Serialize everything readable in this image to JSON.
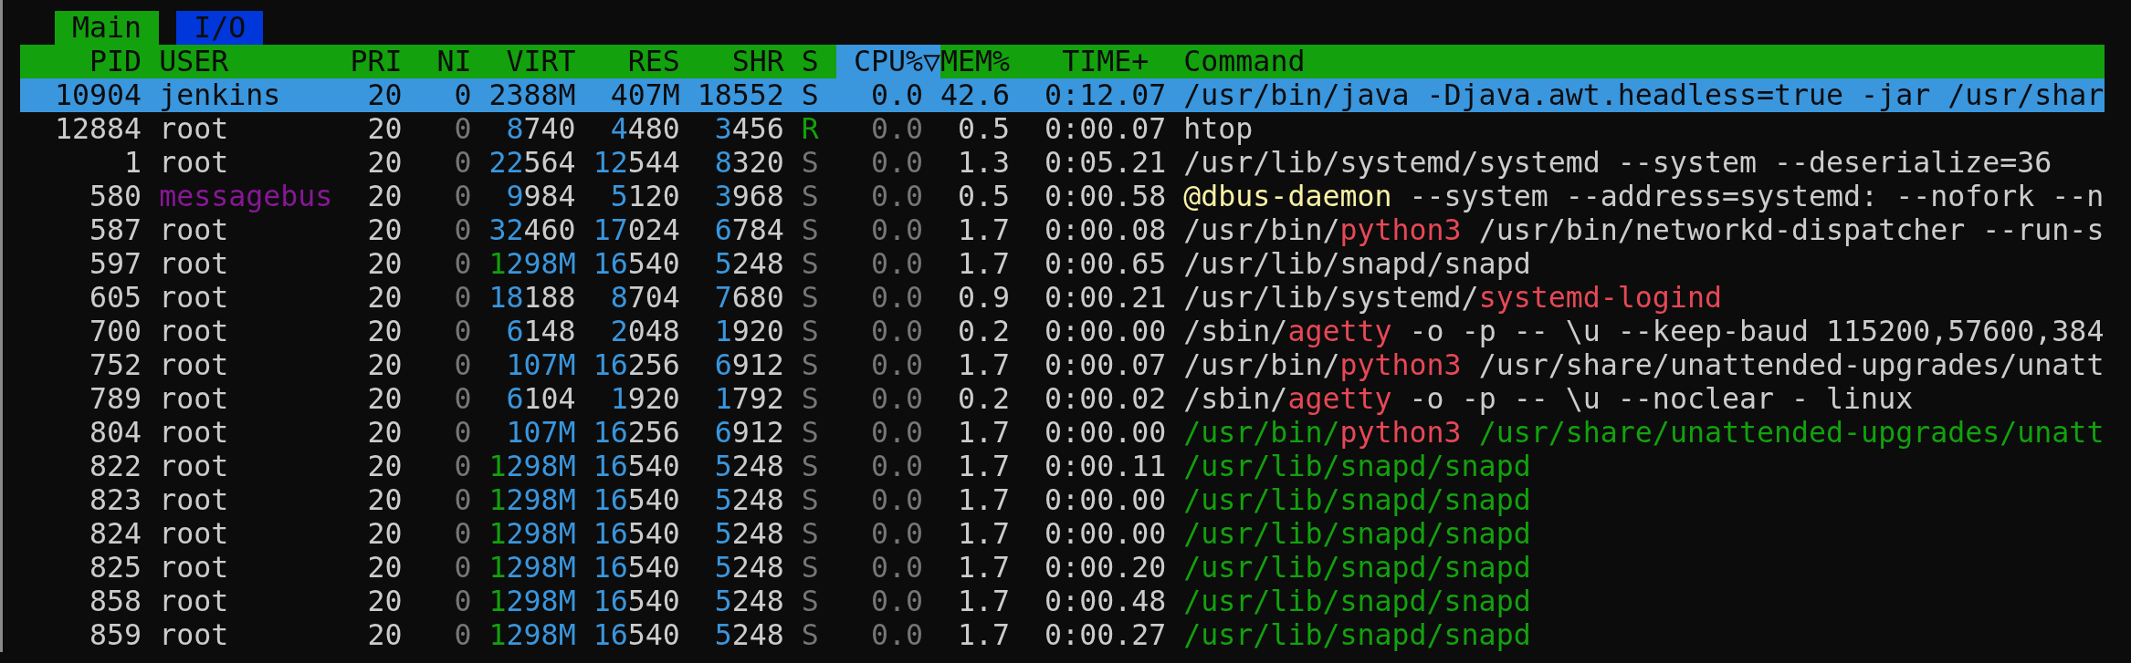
{
  "tabs": [
    {
      "label": "Main",
      "selected": true
    },
    {
      "label": "I/O",
      "selected": false
    }
  ],
  "columns": [
    {
      "label": "PID",
      "sorted": false
    },
    {
      "label": "USER",
      "sorted": false
    },
    {
      "label": "PRI",
      "sorted": false
    },
    {
      "label": "NI",
      "sorted": false
    },
    {
      "label": "VIRT",
      "sorted": false
    },
    {
      "label": "RES",
      "sorted": false
    },
    {
      "label": "SHR",
      "sorted": false
    },
    {
      "label": "S",
      "sorted": false
    },
    {
      "label": "CPU%",
      "sorted": true,
      "sort_indicator": "▽"
    },
    {
      "label": "MEM%",
      "sorted": false
    },
    {
      "label": "TIME+",
      "sorted": false
    },
    {
      "label": "Command",
      "sorted": false
    }
  ],
  "rows": [
    {
      "selected": true,
      "pid": "10904",
      "user": "jenkins",
      "pri": "20",
      "ni": "0",
      "virt": "2388M",
      "res": "407M",
      "shr": "18552",
      "state": "S",
      "cpu": "0.0",
      "mem": "42.6",
      "time": "0:12.07",
      "command": "/usr/bin/java -Djava.awt.headless=true -jar /usr/shar"
    },
    {
      "selected": false,
      "pid": "12884",
      "user": "root",
      "pri": "20",
      "ni": [
        {
          "text": "0",
          "color": "#767676"
        }
      ],
      "virt": [
        {
          "text": "8",
          "color": "#3a96dd"
        },
        {
          "text": "740",
          "color": "#cccccc"
        }
      ],
      "res": [
        {
          "text": "4",
          "color": "#3a96dd"
        },
        {
          "text": "480",
          "color": "#cccccc"
        }
      ],
      "shr": [
        {
          "text": "3",
          "color": "#3a96dd"
        },
        {
          "text": "456",
          "color": "#cccccc"
        }
      ],
      "state": [
        {
          "text": "R",
          "color": "#13a10e"
        }
      ],
      "cpu": [
        {
          "text": "0.0",
          "color": "#767676"
        }
      ],
      "mem": "0.5",
      "time": "0:00.07",
      "command": "htop"
    },
    {
      "selected": false,
      "pid": "1",
      "user": "root",
      "pri": "20",
      "ni": [
        {
          "text": "0",
          "color": "#767676"
        }
      ],
      "virt": [
        {
          "text": "22",
          "color": "#3a96dd"
        },
        {
          "text": "564",
          "color": "#cccccc"
        }
      ],
      "res": [
        {
          "text": "12",
          "color": "#3a96dd"
        },
        {
          "text": "544",
          "color": "#cccccc"
        }
      ],
      "shr": [
        {
          "text": "8",
          "color": "#3a96dd"
        },
        {
          "text": "320",
          "color": "#cccccc"
        }
      ],
      "state": [
        {
          "text": "S",
          "color": "#767676"
        }
      ],
      "cpu": [
        {
          "text": "0.0",
          "color": "#767676"
        }
      ],
      "mem": "1.3",
      "time": "0:05.21",
      "command": "/usr/lib/systemd/systemd --system --deserialize=36"
    },
    {
      "selected": false,
      "pid": "580",
      "user": [
        {
          "text": "messagebus",
          "color": "#881798"
        }
      ],
      "pri": "20",
      "ni": [
        {
          "text": "0",
          "color": "#767676"
        }
      ],
      "virt": [
        {
          "text": "9",
          "color": "#3a96dd"
        },
        {
          "text": "984",
          "color": "#cccccc"
        }
      ],
      "res": [
        {
          "text": "5",
          "color": "#3a96dd"
        },
        {
          "text": "120",
          "color": "#cccccc"
        }
      ],
      "shr": [
        {
          "text": "3",
          "color": "#3a96dd"
        },
        {
          "text": "968",
          "color": "#cccccc"
        }
      ],
      "state": [
        {
          "text": "S",
          "color": "#767676"
        }
      ],
      "cpu": [
        {
          "text": "0.0",
          "color": "#767676"
        }
      ],
      "mem": "0.5",
      "time": "0:00.58",
      "command": [
        {
          "text": "@dbus-daemon",
          "color": "#f9f1a5"
        },
        {
          "text": " --system --address=systemd: --nofork --n",
          "color": "#cccccc"
        }
      ]
    },
    {
      "selected": false,
      "pid": "587",
      "user": "root",
      "pri": "20",
      "ni": [
        {
          "text": "0",
          "color": "#767676"
        }
      ],
      "virt": [
        {
          "text": "32",
          "color": "#3a96dd"
        },
        {
          "text": "460",
          "color": "#cccccc"
        }
      ],
      "res": [
        {
          "text": "17",
          "color": "#3a96dd"
        },
        {
          "text": "024",
          "color": "#cccccc"
        }
      ],
      "shr": [
        {
          "text": "6",
          "color": "#3a96dd"
        },
        {
          "text": "784",
          "color": "#cccccc"
        }
      ],
      "state": [
        {
          "text": "S",
          "color": "#767676"
        }
      ],
      "cpu": [
        {
          "text": "0.0",
          "color": "#767676"
        }
      ],
      "mem": "1.7",
      "time": "0:00.08",
      "command": [
        {
          "text": "/usr/bin/",
          "color": "#cccccc"
        },
        {
          "text": "python3",
          "color": "#e74856"
        },
        {
          "text": " /usr/bin/networkd-dispatcher --run-s",
          "color": "#cccccc"
        }
      ]
    },
    {
      "selected": false,
      "pid": "597",
      "user": "root",
      "pri": "20",
      "ni": [
        {
          "text": "0",
          "color": "#767676"
        }
      ],
      "virt": [
        {
          "text": "1",
          "color": "#13a10e"
        },
        {
          "text": "298M",
          "color": "#3a96dd"
        }
      ],
      "res": [
        {
          "text": "16",
          "color": "#3a96dd"
        },
        {
          "text": "540",
          "color": "#cccccc"
        }
      ],
      "shr": [
        {
          "text": "5",
          "color": "#3a96dd"
        },
        {
          "text": "248",
          "color": "#cccccc"
        }
      ],
      "state": [
        {
          "text": "S",
          "color": "#767676"
        }
      ],
      "cpu": [
        {
          "text": "0.0",
          "color": "#767676"
        }
      ],
      "mem": "1.7",
      "time": "0:00.65",
      "command": "/usr/lib/snapd/snapd"
    },
    {
      "selected": false,
      "pid": "605",
      "user": "root",
      "pri": "20",
      "ni": [
        {
          "text": "0",
          "color": "#767676"
        }
      ],
      "virt": [
        {
          "text": "18",
          "color": "#3a96dd"
        },
        {
          "text": "188",
          "color": "#cccccc"
        }
      ],
      "res": [
        {
          "text": "8",
          "color": "#3a96dd"
        },
        {
          "text": "704",
          "color": "#cccccc"
        }
      ],
      "shr": [
        {
          "text": "7",
          "color": "#3a96dd"
        },
        {
          "text": "680",
          "color": "#cccccc"
        }
      ],
      "state": [
        {
          "text": "S",
          "color": "#767676"
        }
      ],
      "cpu": [
        {
          "text": "0.0",
          "color": "#767676"
        }
      ],
      "mem": "0.9",
      "time": "0:00.21",
      "command": [
        {
          "text": "/usr/lib/systemd/",
          "color": "#cccccc"
        },
        {
          "text": "systemd-logind",
          "color": "#e74856"
        }
      ]
    },
    {
      "selected": false,
      "pid": "700",
      "user": "root",
      "pri": "20",
      "ni": [
        {
          "text": "0",
          "color": "#767676"
        }
      ],
      "virt": [
        {
          "text": "6",
          "color": "#3a96dd"
        },
        {
          "text": "148",
          "color": "#cccccc"
        }
      ],
      "res": [
        {
          "text": "2",
          "color": "#3a96dd"
        },
        {
          "text": "048",
          "color": "#cccccc"
        }
      ],
      "shr": [
        {
          "text": "1",
          "color": "#3a96dd"
        },
        {
          "text": "920",
          "color": "#cccccc"
        }
      ],
      "state": [
        {
          "text": "S",
          "color": "#767676"
        }
      ],
      "cpu": [
        {
          "text": "0.0",
          "color": "#767676"
        }
      ],
      "mem": "0.2",
      "time": "0:00.00",
      "command": [
        {
          "text": "/sbin/",
          "color": "#cccccc"
        },
        {
          "text": "agetty",
          "color": "#e74856"
        },
        {
          "text": " -o -p -- \\u --keep-baud 115200,57600,384",
          "color": "#cccccc"
        }
      ]
    },
    {
      "selected": false,
      "pid": "752",
      "user": "root",
      "pri": "20",
      "ni": [
        {
          "text": "0",
          "color": "#767676"
        }
      ],
      "virt": [
        {
          "text": "107M",
          "color": "#3a96dd"
        }
      ],
      "res": [
        {
          "text": "16",
          "color": "#3a96dd"
        },
        {
          "text": "256",
          "color": "#cccccc"
        }
      ],
      "shr": [
        {
          "text": "6",
          "color": "#3a96dd"
        },
        {
          "text": "912",
          "color": "#cccccc"
        }
      ],
      "state": [
        {
          "text": "S",
          "color": "#767676"
        }
      ],
      "cpu": [
        {
          "text": "0.0",
          "color": "#767676"
        }
      ],
      "mem": "1.7",
      "time": "0:00.07",
      "command": [
        {
          "text": "/usr/bin/",
          "color": "#cccccc"
        },
        {
          "text": "python3",
          "color": "#e74856"
        },
        {
          "text": " /usr/share/unattended-upgrades/unatt",
          "color": "#cccccc"
        }
      ]
    },
    {
      "selected": false,
      "pid": "789",
      "user": "root",
      "pri": "20",
      "ni": [
        {
          "text": "0",
          "color": "#767676"
        }
      ],
      "virt": [
        {
          "text": "6",
          "color": "#3a96dd"
        },
        {
          "text": "104",
          "color": "#cccccc"
        }
      ],
      "res": [
        {
          "text": "1",
          "color": "#3a96dd"
        },
        {
          "text": "920",
          "color": "#cccccc"
        }
      ],
      "shr": [
        {
          "text": "1",
          "color": "#3a96dd"
        },
        {
          "text": "792",
          "color": "#cccccc"
        }
      ],
      "state": [
        {
          "text": "S",
          "color": "#767676"
        }
      ],
      "cpu": [
        {
          "text": "0.0",
          "color": "#767676"
        }
      ],
      "mem": "0.2",
      "time": "0:00.02",
      "command": [
        {
          "text": "/sbin/",
          "color": "#cccccc"
        },
        {
          "text": "agetty",
          "color": "#e74856"
        },
        {
          "text": " -o -p -- \\u --noclear - linux",
          "color": "#cccccc"
        }
      ]
    },
    {
      "selected": false,
      "pid": "804",
      "user": "root",
      "pri": "20",
      "ni": [
        {
          "text": "0",
          "color": "#767676"
        }
      ],
      "virt": [
        {
          "text": "107M",
          "color": "#3a96dd"
        }
      ],
      "res": [
        {
          "text": "16",
          "color": "#3a96dd"
        },
        {
          "text": "256",
          "color": "#cccccc"
        }
      ],
      "shr": [
        {
          "text": "6",
          "color": "#3a96dd"
        },
        {
          "text": "912",
          "color": "#cccccc"
        }
      ],
      "state": [
        {
          "text": "S",
          "color": "#767676"
        }
      ],
      "cpu": [
        {
          "text": "0.0",
          "color": "#767676"
        }
      ],
      "mem": "1.7",
      "time": "0:00.00",
      "command": [
        {
          "text": "/usr/bin/",
          "color": "#13a10e"
        },
        {
          "text": "python3",
          "color": "#e74856"
        },
        {
          "text": " /usr/share/unattended-upgrades/unatt",
          "color": "#13a10e"
        }
      ]
    },
    {
      "selected": false,
      "pid": "822",
      "user": "root",
      "pri": "20",
      "ni": [
        {
          "text": "0",
          "color": "#767676"
        }
      ],
      "virt": [
        {
          "text": "1",
          "color": "#13a10e"
        },
        {
          "text": "298M",
          "color": "#3a96dd"
        }
      ],
      "res": [
        {
          "text": "16",
          "color": "#3a96dd"
        },
        {
          "text": "540",
          "color": "#cccccc"
        }
      ],
      "shr": [
        {
          "text": "5",
          "color": "#3a96dd"
        },
        {
          "text": "248",
          "color": "#cccccc"
        }
      ],
      "state": [
        {
          "text": "S",
          "color": "#767676"
        }
      ],
      "cpu": [
        {
          "text": "0.0",
          "color": "#767676"
        }
      ],
      "mem": "1.7",
      "time": "0:00.11",
      "command": [
        {
          "text": "/usr/lib/snapd/snapd",
          "color": "#13a10e"
        }
      ]
    },
    {
      "selected": false,
      "pid": "823",
      "user": "root",
      "pri": "20",
      "ni": [
        {
          "text": "0",
          "color": "#767676"
        }
      ],
      "virt": [
        {
          "text": "1",
          "color": "#13a10e"
        },
        {
          "text": "298M",
          "color": "#3a96dd"
        }
      ],
      "res": [
        {
          "text": "16",
          "color": "#3a96dd"
        },
        {
          "text": "540",
          "color": "#cccccc"
        }
      ],
      "shr": [
        {
          "text": "5",
          "color": "#3a96dd"
        },
        {
          "text": "248",
          "color": "#cccccc"
        }
      ],
      "state": [
        {
          "text": "S",
          "color": "#767676"
        }
      ],
      "cpu": [
        {
          "text": "0.0",
          "color": "#767676"
        }
      ],
      "mem": "1.7",
      "time": "0:00.00",
      "command": [
        {
          "text": "/usr/lib/snapd/snapd",
          "color": "#13a10e"
        }
      ]
    },
    {
      "selected": false,
      "pid": "824",
      "user": "root",
      "pri": "20",
      "ni": [
        {
          "text": "0",
          "color": "#767676"
        }
      ],
      "virt": [
        {
          "text": "1",
          "color": "#13a10e"
        },
        {
          "text": "298M",
          "color": "#3a96dd"
        }
      ],
      "res": [
        {
          "text": "16",
          "color": "#3a96dd"
        },
        {
          "text": "540",
          "color": "#cccccc"
        }
      ],
      "shr": [
        {
          "text": "5",
          "color": "#3a96dd"
        },
        {
          "text": "248",
          "color": "#cccccc"
        }
      ],
      "state": [
        {
          "text": "S",
          "color": "#767676"
        }
      ],
      "cpu": [
        {
          "text": "0.0",
          "color": "#767676"
        }
      ],
      "mem": "1.7",
      "time": "0:00.00",
      "command": [
        {
          "text": "/usr/lib/snapd/snapd",
          "color": "#13a10e"
        }
      ]
    },
    {
      "selected": false,
      "pid": "825",
      "user": "root",
      "pri": "20",
      "ni": [
        {
          "text": "0",
          "color": "#767676"
        }
      ],
      "virt": [
        {
          "text": "1",
          "color": "#13a10e"
        },
        {
          "text": "298M",
          "color": "#3a96dd"
        }
      ],
      "res": [
        {
          "text": "16",
          "color": "#3a96dd"
        },
        {
          "text": "540",
          "color": "#cccccc"
        }
      ],
      "shr": [
        {
          "text": "5",
          "color": "#3a96dd"
        },
        {
          "text": "248",
          "color": "#cccccc"
        }
      ],
      "state": [
        {
          "text": "S",
          "color": "#767676"
        }
      ],
      "cpu": [
        {
          "text": "0.0",
          "color": "#767676"
        }
      ],
      "mem": "1.7",
      "time": "0:00.20",
      "command": [
        {
          "text": "/usr/lib/snapd/snapd",
          "color": "#13a10e"
        }
      ]
    },
    {
      "selected": false,
      "pid": "858",
      "user": "root",
      "pri": "20",
      "ni": [
        {
          "text": "0",
          "color": "#767676"
        }
      ],
      "virt": [
        {
          "text": "1",
          "color": "#13a10e"
        },
        {
          "text": "298M",
          "color": "#3a96dd"
        }
      ],
      "res": [
        {
          "text": "16",
          "color": "#3a96dd"
        },
        {
          "text": "540",
          "color": "#cccccc"
        }
      ],
      "shr": [
        {
          "text": "5",
          "color": "#3a96dd"
        },
        {
          "text": "248",
          "color": "#cccccc"
        }
      ],
      "state": [
        {
          "text": "S",
          "color": "#767676"
        }
      ],
      "cpu": [
        {
          "text": "0.0",
          "color": "#767676"
        }
      ],
      "mem": "1.7",
      "time": "0:00.48",
      "command": [
        {
          "text": "/usr/lib/snapd/snapd",
          "color": "#13a10e"
        }
      ]
    },
    {
      "selected": false,
      "pid": "859",
      "user": "root",
      "pri": "20",
      "ni": [
        {
          "text": "0",
          "color": "#767676"
        }
      ],
      "virt": [
        {
          "text": "1",
          "color": "#13a10e"
        },
        {
          "text": "298M",
          "color": "#3a96dd"
        }
      ],
      "res": [
        {
          "text": "16",
          "color": "#3a96dd"
        },
        {
          "text": "540",
          "color": "#cccccc"
        }
      ],
      "shr": [
        {
          "text": "5",
          "color": "#3a96dd"
        },
        {
          "text": "248",
          "color": "#cccccc"
        }
      ],
      "state": [
        {
          "text": "S",
          "color": "#767676"
        }
      ],
      "cpu": [
        {
          "text": "0.0",
          "color": "#767676"
        }
      ],
      "mem": "1.7",
      "time": "0:00.27",
      "command": [
        {
          "text": "/usr/lib/snapd/snapd",
          "color": "#13a10e"
        }
      ]
    }
  ]
}
